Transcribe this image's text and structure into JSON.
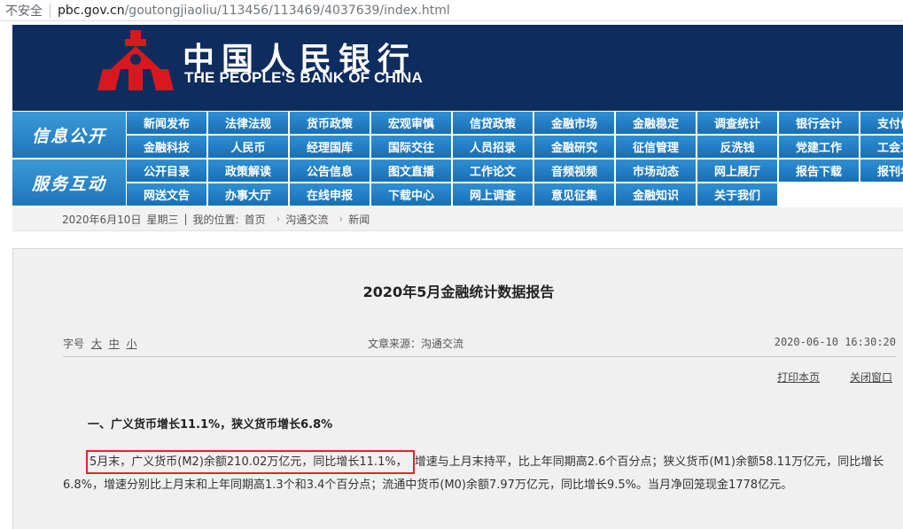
{
  "browser": {
    "insecure_label": "不安全",
    "url_host": "pbc.gov.cn",
    "url_path": "/goutongjiaoliu/113456/113469/4037639/index.html"
  },
  "banner": {
    "cn_name": "中国人民银行",
    "en_name": "THE PEOPLE'S BANK OF CHINA",
    "emblem_icon": "pbc-emblem-icon",
    "colors": {
      "background": "#0e2c5e",
      "emblem": "#d7191f"
    }
  },
  "nav": {
    "sections": [
      {
        "label": "信息公开",
        "row1": [
          "新闻发布",
          "法律法规",
          "货币政策",
          "宏观审慎",
          "信贷政策",
          "金融市场",
          "金融稳定",
          "调查统计",
          "银行会计",
          "支付体系"
        ],
        "row2": [
          "金融科技",
          "人民币",
          "经理国库",
          "国际交往",
          "人员招录",
          "金融研究",
          "征信管理",
          "反洗钱",
          "党建工作",
          "工会工作"
        ]
      },
      {
        "label": "服务互动",
        "row1": [
          "公开目录",
          "政策解读",
          "公告信息",
          "图文直播",
          "工作论文",
          "音频视频",
          "市场动态",
          "网上展厅",
          "报告下载",
          "报刊年鉴"
        ],
        "row2": [
          "网送文告",
          "办事大厅",
          "在线申报",
          "下载中心",
          "网上调查",
          "意见征集",
          "金融知识",
          "关于我们"
        ]
      }
    ],
    "colors": {
      "cell": "#1f7dc3",
      "section": "#2a88cc"
    }
  },
  "breadcrumb": {
    "date": "2020年6月10日",
    "weekday": "星期三",
    "location_label": "我的位置:",
    "items": [
      "首页",
      "沟通交流",
      "新闻"
    ]
  },
  "article": {
    "title": "2020年5月金融统计数据报告",
    "font_size_label": "字号",
    "font_sizes": [
      "大",
      "中",
      "小"
    ],
    "source": "文章来源：沟通交流",
    "datetime": "2020-06-10 16:30:20",
    "print_label": "打印本页",
    "close_label": "关闭窗口",
    "heading": "一、广义货币增长11.1%，狭义货币增长6.8%",
    "para_highlighted": "5月末，广义货币(M2)余额210.02万亿元，同比增长11.1%，",
    "para_rest": "增速与上月末持平，比上年同期高2.6个百分点；狭义货币(M1)余额58.11万亿元，同比增长6.8%，增速分别比上月末和上年同期高1.3个和3.4个百分点；流通中货币(M0)余额7.97万亿元，同比增长9.5%。当月净回笼现金1778亿元。",
    "highlight_color": "#e0262b"
  }
}
